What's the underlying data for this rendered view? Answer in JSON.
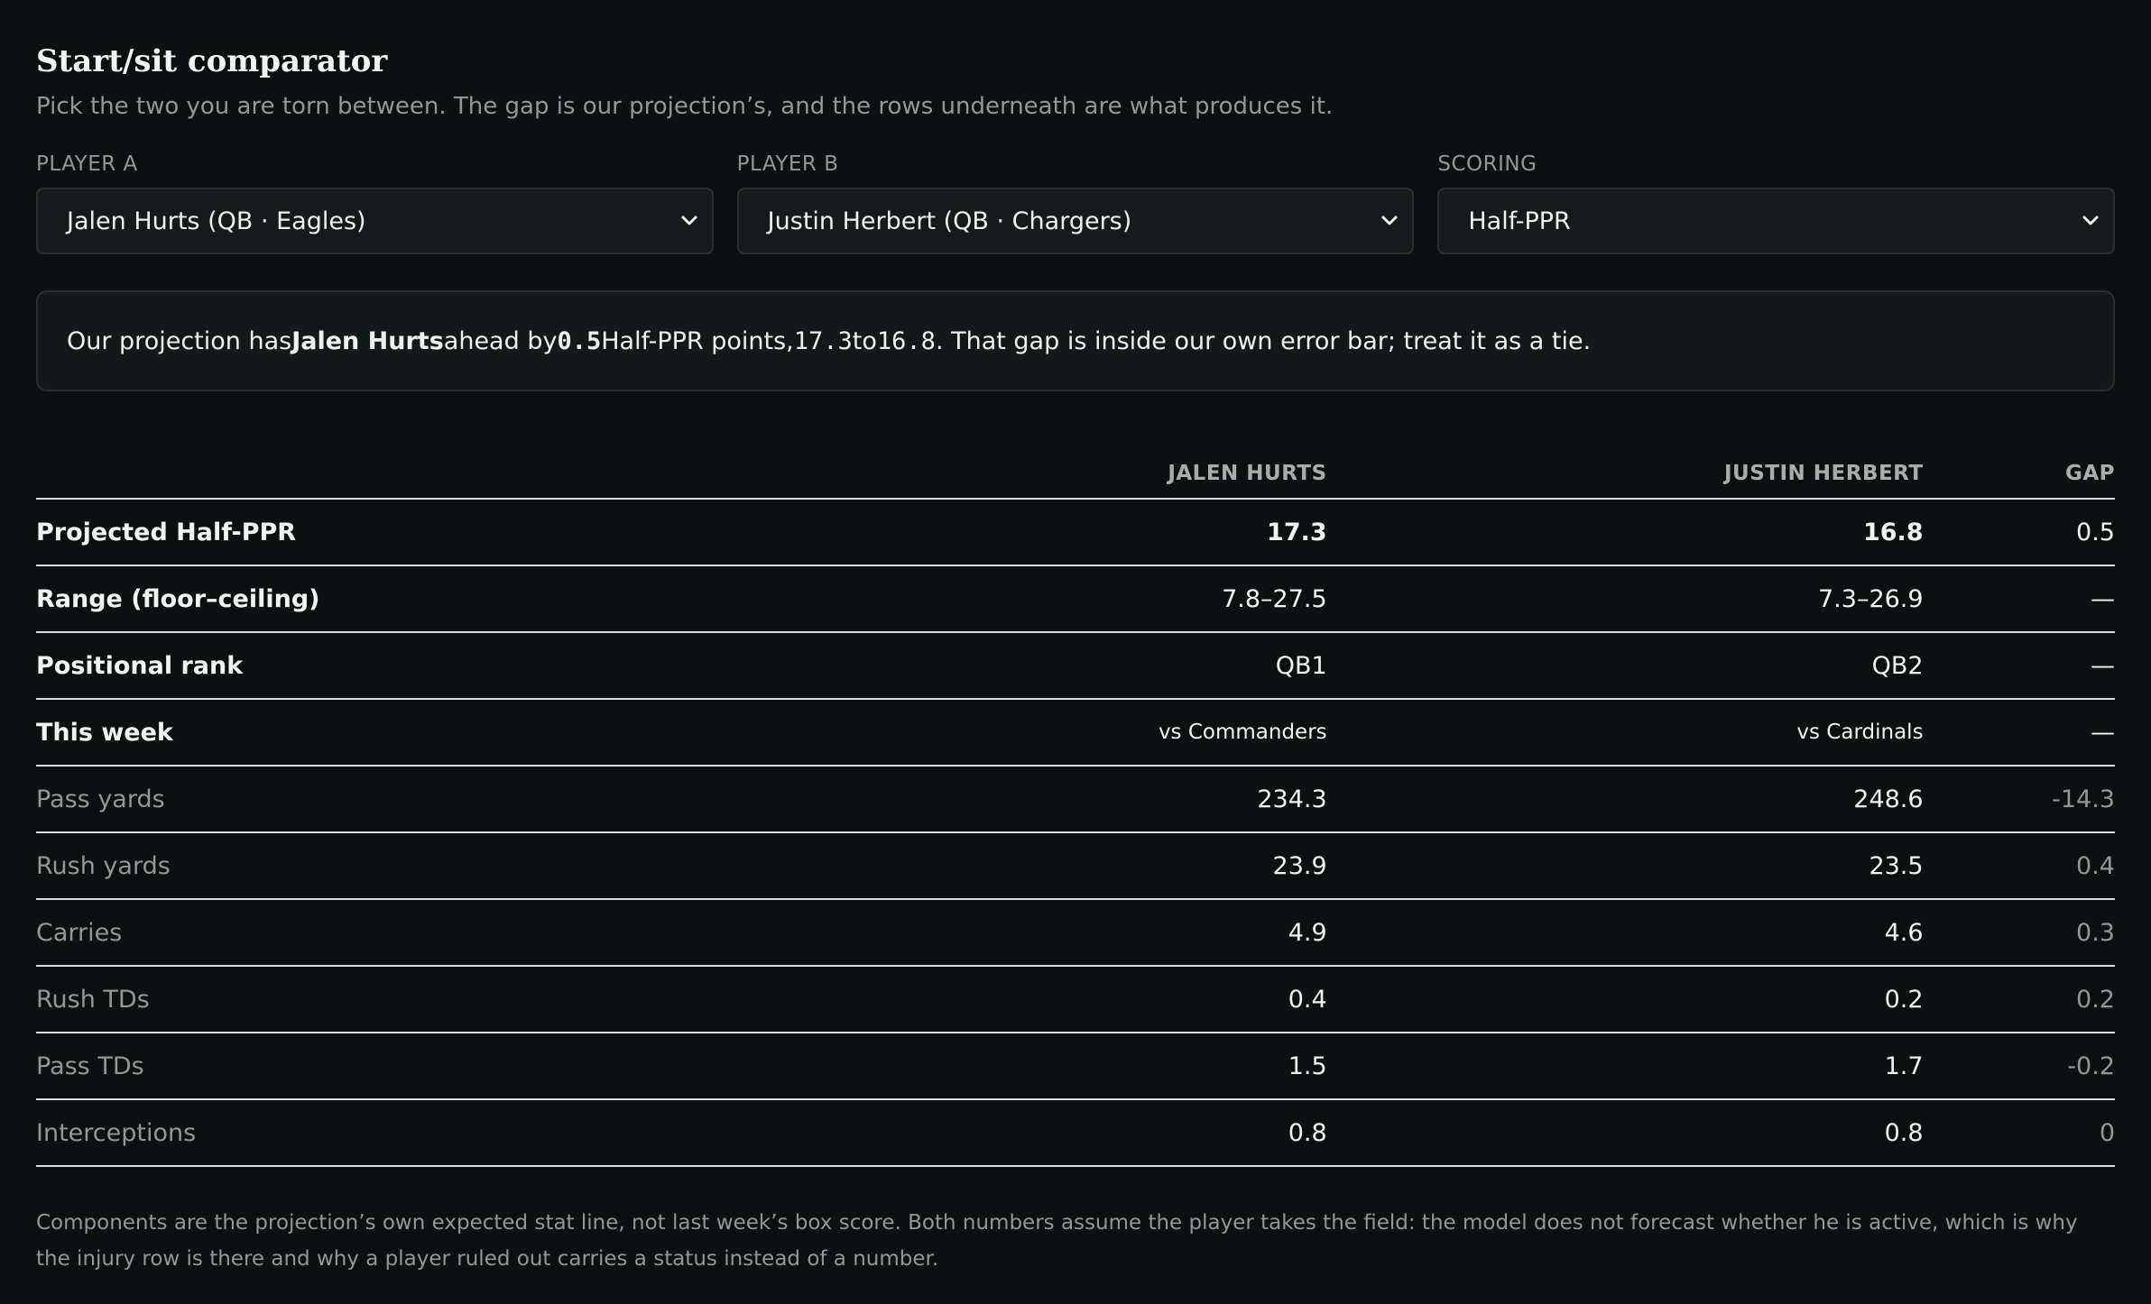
{
  "header": {
    "title": "Start/sit comparator",
    "subtitle": "Pick the two you are torn between. The gap is our projection’s, and the rows underneath are what produces it."
  },
  "controls": {
    "player_a": {
      "label": "PLAYER A",
      "value": "Jalen Hurts (QB · Eagles)"
    },
    "player_b": {
      "label": "PLAYER B",
      "value": "Justin Herbert (QB · Chargers)"
    },
    "scoring": {
      "label": "SCORING",
      "value": "Half-PPR"
    }
  },
  "summary": {
    "prefix": "Our projection has ",
    "leader": "Jalen Hurts",
    "ahead_by": " ahead by ",
    "gap": "0.5",
    "points": " Half-PPR points, ",
    "score_a": "17.3",
    "to": " to ",
    "score_b": "16.8",
    "suffix": ". That gap is inside our own error bar; treat it as a tie."
  },
  "table": {
    "headers": {
      "label": "",
      "player_a": "JALEN HURTS",
      "player_b": "JUSTIN HERBERT",
      "gap": "GAP"
    },
    "rows": [
      {
        "label": "Projected Half-PPR",
        "a": "17.3",
        "b": "16.8",
        "gap": "0.5"
      },
      {
        "label": "Range (floor–ceiling)",
        "a": "7.8–27.5",
        "b": "7.3–26.9",
        "gap": "—"
      },
      {
        "label": "Positional rank",
        "a": "QB1",
        "b": "QB2",
        "gap": "—"
      },
      {
        "label": "This week",
        "a": "vs Commanders",
        "b": "vs Cardinals",
        "gap": "—"
      },
      {
        "label": "Pass yards",
        "a": "234.3",
        "b": "248.6",
        "gap": "-14.3"
      },
      {
        "label": "Rush yards",
        "a": "23.9",
        "b": "23.5",
        "gap": "0.4"
      },
      {
        "label": "Carries",
        "a": "4.9",
        "b": "4.6",
        "gap": "0.3"
      },
      {
        "label": "Rush TDs",
        "a": "0.4",
        "b": "0.2",
        "gap": "0.2"
      },
      {
        "label": "Pass TDs",
        "a": "1.5",
        "b": "1.7",
        "gap": "-0.2"
      },
      {
        "label": "Interceptions",
        "a": "0.8",
        "b": "0.8",
        "gap": "0"
      }
    ]
  },
  "footnote": "Components are the projection’s own expected stat line, not last week’s box score. Both numbers assume the player takes the field: the model does not forecast whether he is active, which is why the injury row is there and why a player ruled out carries a status instead of a number.",
  "icons": {
    "select_chevron": "chevron-down-icon"
  },
  "colors": {
    "background": "#0b1111",
    "panel": "#141c1b",
    "border": "#27322f",
    "muted": "#8e9a95",
    "text": "#eef1ef"
  }
}
